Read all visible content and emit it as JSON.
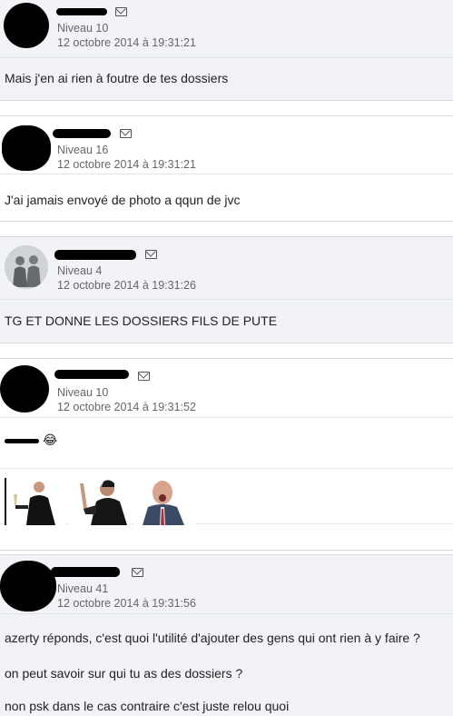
{
  "posts": [
    {
      "level": "Niveau 10",
      "date": "12 octobre 2014 à 19:31:21",
      "messages": [
        "Mais j'en ai rien à foutre de tes dossiers"
      ]
    },
    {
      "level": "Niveau 16",
      "date": "12 octobre 2014 à 19:31:21",
      "messages": [
        "J'ai jamais envoyé de photo a qqun de jvc"
      ]
    },
    {
      "level": "Niveau 4",
      "date": "12 octobre 2014 à 19:31:26",
      "messages": [
        "TG ET DONNE LES DOSSIERS FILS DE PUTE"
      ]
    },
    {
      "level": "Niveau 10",
      "date": "12 octobre 2014 à 19:31:52",
      "messages": [],
      "smiley": "😂",
      "image_count": 3
    },
    {
      "level": "Niveau 41",
      "date": "12 octobre 2014 à 19:31:56",
      "messages": [
        "azerty réponds, c'est quoi l'utilité d'ajouter des gens qui ont rien à y faire ?",
        "on peut savoir sur qui tu as des dossiers ?",
        "non psk dans le cas contraire c'est juste relou quoi"
      ]
    }
  ],
  "icons": {
    "mail": "envelope-icon",
    "smiley": "laughing-smiley-icon"
  },
  "colors": {
    "alt_bg": "#f2f3f6",
    "border": "#d6dae0",
    "meta_text": "#666666"
  }
}
